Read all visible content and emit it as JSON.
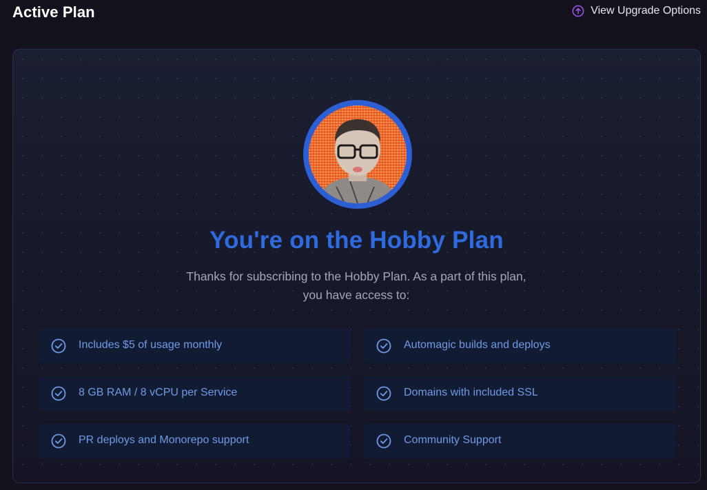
{
  "header": {
    "title": "Active Plan",
    "upgrade_label": "View Upgrade Options",
    "upgrade_icon": "arrow-up-circle-icon"
  },
  "plan": {
    "title": "You're on the Hobby Plan",
    "description_line1": "Thanks for subscribing to the Hobby Plan. As a part of this plan,",
    "description_line2": "you have access to:"
  },
  "features": [
    {
      "label": "Includes $5 of usage monthly",
      "icon": "check-circle-icon"
    },
    {
      "label": "Automagic builds and deploys",
      "icon": "check-circle-icon"
    },
    {
      "label": "8 GB RAM / 8 vCPU per Service",
      "icon": "check-circle-icon"
    },
    {
      "label": "Domains with included SSL",
      "icon": "check-circle-icon"
    },
    {
      "label": "PR deploys and Monorepo support",
      "icon": "check-circle-icon"
    },
    {
      "label": "Community Support",
      "icon": "check-circle-icon"
    }
  ],
  "colors": {
    "accent": "#2f6bdf",
    "upgrade_icon": "#a855f7",
    "feature_text": "#6e9ae8",
    "background": "#13111c"
  }
}
